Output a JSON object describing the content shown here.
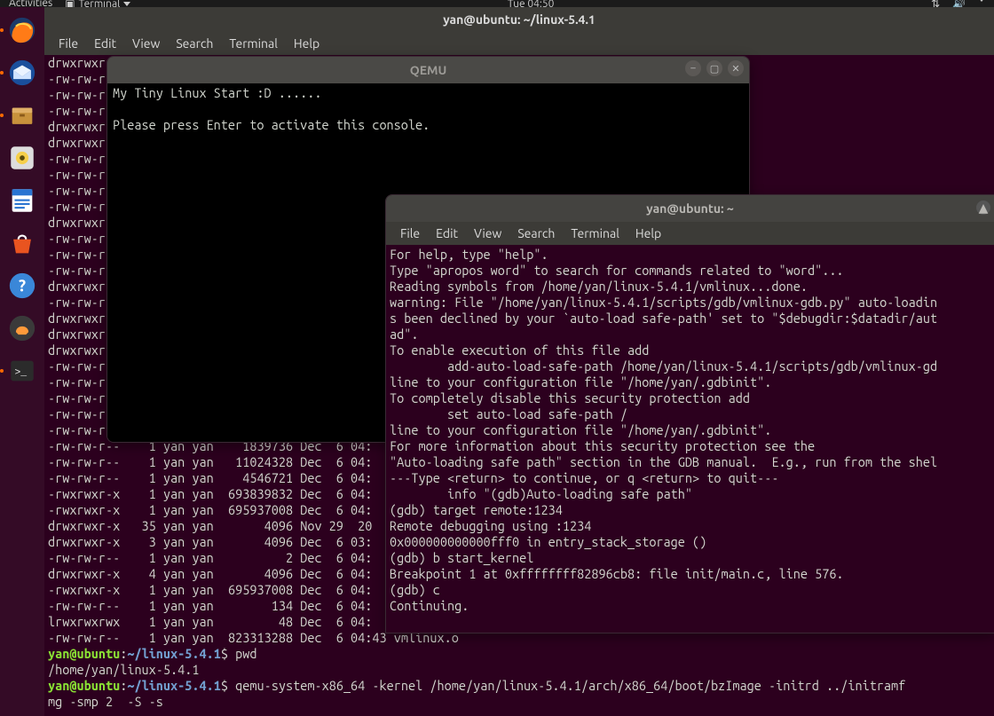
{
  "top_panel": {
    "activities": "Activities",
    "app_label": "Terminal",
    "clock": "Tue 04:50"
  },
  "bg_terminal": {
    "title": "yan@ubuntu: ~/linux-5.4.1",
    "menu": {
      "file": "File",
      "edit": "Edit",
      "view": "View",
      "search": "Search",
      "terminal": "Terminal",
      "help": "Help"
    },
    "listing": [
      "drwxrwxr-x",
      "-rw-rw-r-",
      "-rw-rw-r-",
      "-rw-rw-r-",
      "drwxrwxr-x",
      "drwxrwxr-x",
      "-rw-rw-r-",
      "-rw-rw-r-",
      "-rw-rw-r-",
      "-rw-rw-r-",
      "drwxrwxr-x",
      "-rw-rw-r-",
      "-rw-rw-r-",
      "-rw-rw-r-",
      "drwxrwxr-x",
      "-rw-rw-r-",
      "drwxrwxr-x",
      "drwxrwxr-x",
      "drwxrwxr-x",
      "-rw-rw-r-",
      "-rw-rw-r-",
      "-rw-rw-r-",
      "-rw-rw-r-",
      "-rw-rw-r-",
      "-rw-rw-r--    1 yan yan    1839736 Dec  6 04:",
      "-rw-rw-r--    1 yan yan   11024328 Dec  6 04:",
      "-rw-rw-r--    1 yan yan    4546721 Dec  6 04:",
      "-rwxrwxr-x    1 yan yan  693839832 Dec  6 04:",
      "-rwxrwxr-x    1 yan yan  695937008 Dec  6 04:",
      "drwxrwxr-x   35 yan yan       4096 Nov 29  20",
      "drwxrwxr-x    3 yan yan       4096 Dec  6 03:",
      "-rw-rw-r--    1 yan yan          2 Dec  6 04:",
      "drwxrwxr-x    4 yan yan       4096 Dec  6 04:",
      "-rwxrwxr-x    1 yan yan  695937008 Dec  6 04:",
      "-rw-rw-r--    1 yan yan        134 Dec  6 04:",
      "lrwxrwxrwx    1 yan yan         48 Dec  6 04:",
      "-rw-rw-r--    1 yan yan  823313288 Dec  6 04:43 vmlinux.o"
    ],
    "prompt1": {
      "userhost": "yan@ubuntu",
      "colon": ":",
      "path": "~/linux-5.4.1",
      "sep": "$ ",
      "cmd": "pwd"
    },
    "pwd_out": "/home/yan/linux-5.4.1",
    "prompt2": {
      "userhost": "yan@ubuntu",
      "colon": ":",
      "path": "~/linux-5.4.1",
      "sep": "$ ",
      "cmd": "qemu-system-x86_64 -kernel /home/yan/linux-5.4.1/arch/x86_64/boot/bzImage -initrd ../initramf"
    },
    "prompt2_cont": "mg -smp 2  -S -s"
  },
  "qemu": {
    "title": "QEMU",
    "line1": "My Tiny Linux Start :D ......",
    "line2": "Please press Enter to activate this console."
  },
  "gdb_terminal": {
    "title": "yan@ubuntu: ~",
    "menu": {
      "file": "File",
      "edit": "Edit",
      "view": "View",
      "search": "Search",
      "terminal": "Terminal",
      "help": "Help"
    },
    "lines": [
      "For help, type \"help\".",
      "Type \"apropos word\" to search for commands related to \"word\"...",
      "Reading symbols from /home/yan/linux-5.4.1/vmlinux...done.",
      "warning: File \"/home/yan/linux-5.4.1/scripts/gdb/vmlinux-gdb.py\" auto-loadin",
      "s been declined by your `auto-load safe-path' set to \"$debugdir:$datadir/aut",
      "ad\".",
      "To enable execution of this file add",
      "        add-auto-load-safe-path /home/yan/linux-5.4.1/scripts/gdb/vmlinux-gd",
      "line to your configuration file \"/home/yan/.gdbinit\".",
      "To completely disable this security protection add",
      "        set auto-load safe-path /",
      "line to your configuration file \"/home/yan/.gdbinit\".",
      "For more information about this security protection see the",
      "\"Auto-loading safe path\" section in the GDB manual.  E.g., run from the shel",
      "---Type <return> to continue, or q <return> to quit---",
      "        info \"(gdb)Auto-loading safe path\"",
      "(gdb) target remote:1234",
      "Remote debugging using :1234",
      "0x000000000000fff0 in entry_stack_storage ()",
      "(gdb) b start_kernel",
      "Breakpoint 1 at 0xffffffff82896cb8: file init/main.c, line 576.",
      "(gdb) c",
      "Continuing."
    ]
  }
}
